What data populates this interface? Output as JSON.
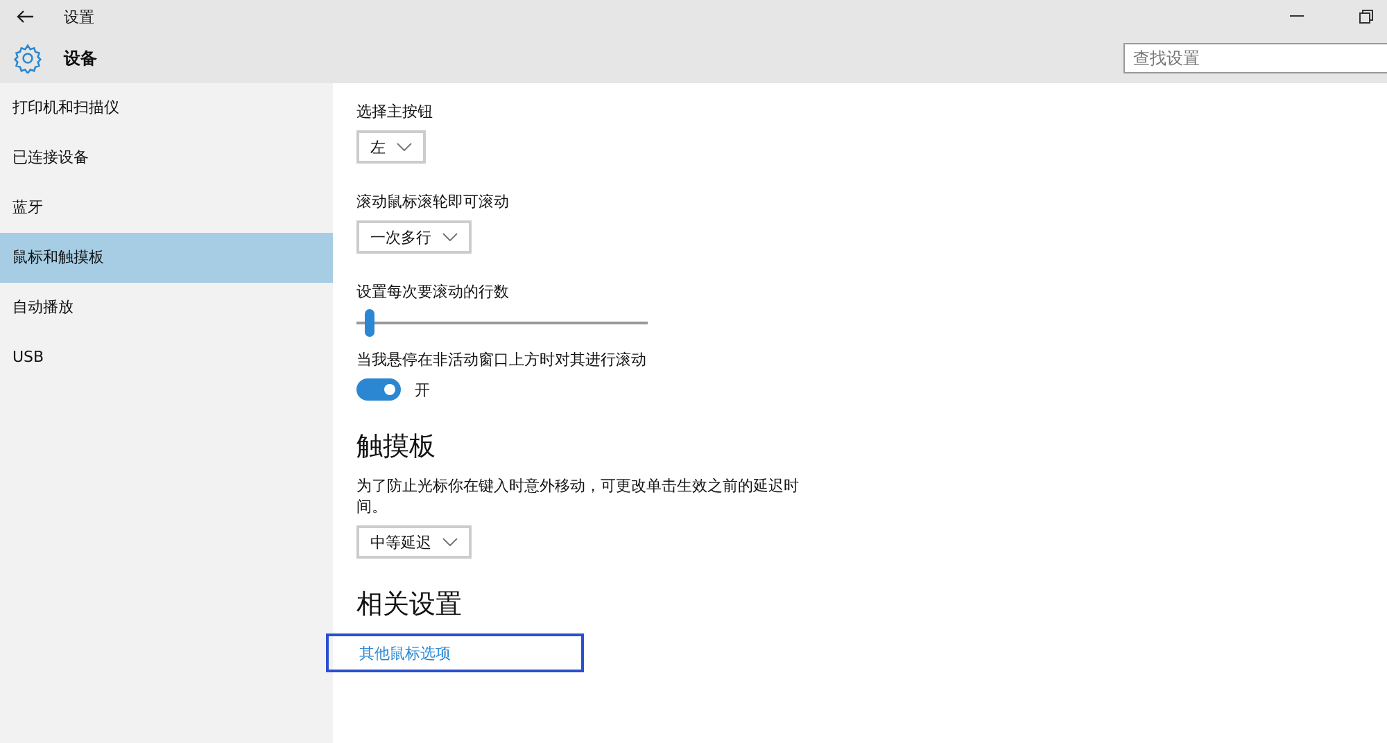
{
  "window": {
    "title": "设置"
  },
  "header": {
    "title": "设备",
    "search": {
      "placeholder": "查找设置"
    }
  },
  "sidebar": {
    "items": [
      {
        "label": "打印机和扫描仪",
        "selected": false
      },
      {
        "label": "已连接设备",
        "selected": false
      },
      {
        "label": "蓝牙",
        "selected": false
      },
      {
        "label": "鼠标和触摸板",
        "selected": true
      },
      {
        "label": "自动播放",
        "selected": false
      },
      {
        "label": "USB",
        "selected": false
      }
    ]
  },
  "content": [
    {
      "kind": "dropdown",
      "label": "选择主按钮",
      "value": "左"
    },
    {
      "kind": "dropdown",
      "label": "滚动鼠标滚轮即可滚动",
      "value": "一次多行"
    },
    {
      "kind": "slider",
      "label": "设置每次要滚动的行数",
      "level": 0.03
    },
    {
      "kind": "toggle",
      "label": "当我悬停在非活动窗口上方时对其进行滚动",
      "on": true,
      "state": "开"
    },
    {
      "kind": "heading",
      "label": "触摸板"
    },
    {
      "kind": "dropdown",
      "label": "为了防止光标你在键入时意外移动，可更改单击生效之前的延迟时间。",
      "value": "中等延迟"
    },
    {
      "kind": "heading",
      "label": "相关设置"
    },
    {
      "kind": "link",
      "label": "其他鼠标选项",
      "highlighted": true
    }
  ]
}
